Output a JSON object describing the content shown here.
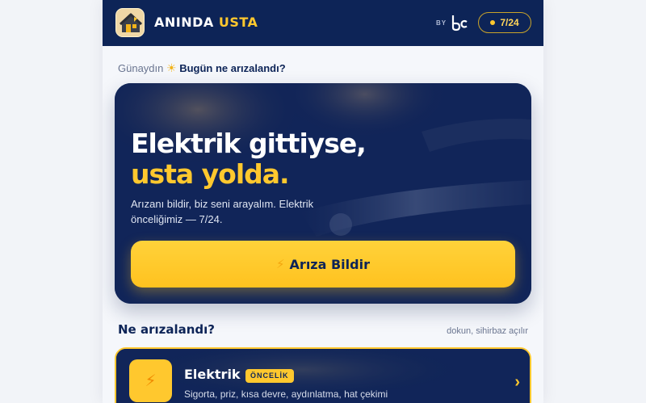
{
  "header": {
    "brand_part1": "ANINDA",
    "brand_part2": "USTA",
    "by_label": "BY",
    "partner_logo_icon": "bc-logo-icon",
    "hours_badge": "7/24",
    "accent_color": "#ffc82e",
    "background_color": "#0d2457"
  },
  "greeting": {
    "hello": "Günaydın",
    "icon": "sun-icon",
    "question": "Bugün ne arızalandı?"
  },
  "hero": {
    "title_line1": "Elektrik gittiyse,",
    "title_line2": "usta yolda.",
    "description": "Arızanı bildir, biz seni arayalım. Elektrik önceliğimiz — 7/24.",
    "cta_icon": "lightning-icon",
    "cta_label": "Arıza Bildir"
  },
  "section": {
    "title": "Ne arızalandı?",
    "hint": "dokun, sihirbaz açılır"
  },
  "categories": [
    {
      "icon": "lightning-icon",
      "title": "Elektrik",
      "badge": "ÖNCELİK",
      "description": "Sigorta, priz, kısa devre, aydınlatma, hat çekimi"
    }
  ]
}
